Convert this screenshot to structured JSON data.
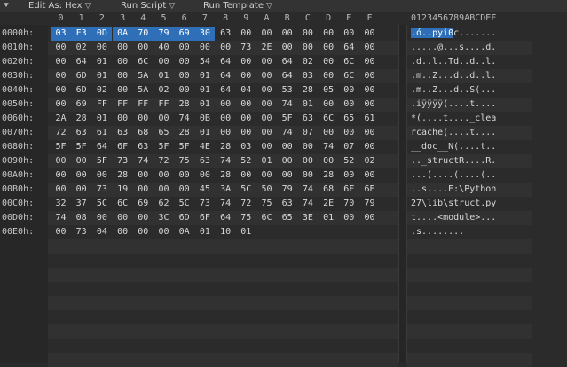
{
  "toolbar": {
    "edit_as_label": "Edit As:",
    "edit_as_value": "Hex",
    "run_script_label": "Run Script",
    "run_template_label": "Run Template",
    "caret": "▽",
    "menu_icon": "download-arrow-icon",
    "menu_icon_glyph": "⯆"
  },
  "columns": {
    "hex": [
      "0",
      "1",
      "2",
      "3",
      "4",
      "5",
      "6",
      "7",
      "8",
      "9",
      "A",
      "B",
      "C",
      "D",
      "E",
      "F"
    ],
    "ascii": "0123456789ABCDEF"
  },
  "selection": {
    "row": 0,
    "start": 0,
    "end": 7
  },
  "colors": {
    "selection": "#2e6fb8",
    "background": "#2b2b2b"
  },
  "rows": [
    {
      "offset": "0000h:",
      "bytes": [
        "03",
        "F3",
        "0D",
        "0A",
        "70",
        "79",
        "69",
        "30",
        "63",
        "00",
        "00",
        "00",
        "00",
        "00",
        "00",
        "00"
      ],
      "ascii": ".ó..pyi0c......."
    },
    {
      "offset": "0010h:",
      "bytes": [
        "00",
        "02",
        "00",
        "00",
        "00",
        "40",
        "00",
        "00",
        "00",
        "73",
        "2E",
        "00",
        "00",
        "00",
        "64",
        "00"
      ],
      "ascii": ".....@...s....d."
    },
    {
      "offset": "0020h:",
      "bytes": [
        "00",
        "64",
        "01",
        "00",
        "6C",
        "00",
        "00",
        "54",
        "64",
        "00",
        "00",
        "64",
        "02",
        "00",
        "6C",
        "00"
      ],
      "ascii": ".d..l..Td..d..l."
    },
    {
      "offset": "0030h:",
      "bytes": [
        "00",
        "6D",
        "01",
        "00",
        "5A",
        "01",
        "00",
        "01",
        "64",
        "00",
        "00",
        "64",
        "03",
        "00",
        "6C",
        "00"
      ],
      "ascii": ".m..Z...d..d..l."
    },
    {
      "offset": "0040h:",
      "bytes": [
        "00",
        "6D",
        "02",
        "00",
        "5A",
        "02",
        "00",
        "01",
        "64",
        "04",
        "00",
        "53",
        "28",
        "05",
        "00",
        "00"
      ],
      "ascii": ".m..Z...d..S(..."
    },
    {
      "offset": "0050h:",
      "bytes": [
        "00",
        "69",
        "FF",
        "FF",
        "FF",
        "FF",
        "28",
        "01",
        "00",
        "00",
        "00",
        "74",
        "01",
        "00",
        "00",
        "00"
      ],
      "ascii": ".iÿÿÿÿ(....t...."
    },
    {
      "offset": "0060h:",
      "bytes": [
        "2A",
        "28",
        "01",
        "00",
        "00",
        "00",
        "74",
        "0B",
        "00",
        "00",
        "00",
        "5F",
        "63",
        "6C",
        "65",
        "61"
      ],
      "ascii": "*(....t...._clea"
    },
    {
      "offset": "0070h:",
      "bytes": [
        "72",
        "63",
        "61",
        "63",
        "68",
        "65",
        "28",
        "01",
        "00",
        "00",
        "00",
        "74",
        "07",
        "00",
        "00",
        "00"
      ],
      "ascii": "rcache(....t...."
    },
    {
      "offset": "0080h:",
      "bytes": [
        "5F",
        "5F",
        "64",
        "6F",
        "63",
        "5F",
        "5F",
        "4E",
        "28",
        "03",
        "00",
        "00",
        "00",
        "74",
        "07",
        "00"
      ],
      "ascii": "__doc__N(....t.."
    },
    {
      "offset": "0090h:",
      "bytes": [
        "00",
        "00",
        "5F",
        "73",
        "74",
        "72",
        "75",
        "63",
        "74",
        "52",
        "01",
        "00",
        "00",
        "00",
        "52",
        "02"
      ],
      "ascii": ".._structR....R."
    },
    {
      "offset": "00A0h:",
      "bytes": [
        "00",
        "00",
        "00",
        "28",
        "00",
        "00",
        "00",
        "00",
        "28",
        "00",
        "00",
        "00",
        "00",
        "28",
        "00",
        "00"
      ],
      "ascii": "...(....(....(.."
    },
    {
      "offset": "00B0h:",
      "bytes": [
        "00",
        "00",
        "73",
        "19",
        "00",
        "00",
        "00",
        "45",
        "3A",
        "5C",
        "50",
        "79",
        "74",
        "68",
        "6F",
        "6E"
      ],
      "ascii": "..s....E:\\Python"
    },
    {
      "offset": "00C0h:",
      "bytes": [
        "32",
        "37",
        "5C",
        "6C",
        "69",
        "62",
        "5C",
        "73",
        "74",
        "72",
        "75",
        "63",
        "74",
        "2E",
        "70",
        "79"
      ],
      "ascii": "27\\lib\\struct.py"
    },
    {
      "offset": "00D0h:",
      "bytes": [
        "74",
        "08",
        "00",
        "00",
        "00",
        "3C",
        "6D",
        "6F",
        "64",
        "75",
        "6C",
        "65",
        "3E",
        "01",
        "00",
        "00"
      ],
      "ascii": "t....<module>..."
    },
    {
      "offset": "00E0h:",
      "bytes": [
        "00",
        "73",
        "04",
        "00",
        "00",
        "00",
        "0A",
        "01",
        "10",
        "01",
        "",
        "",
        "",
        "",
        "",
        ""
      ],
      "ascii": ".s........"
    }
  ],
  "empty_row_count": 9
}
